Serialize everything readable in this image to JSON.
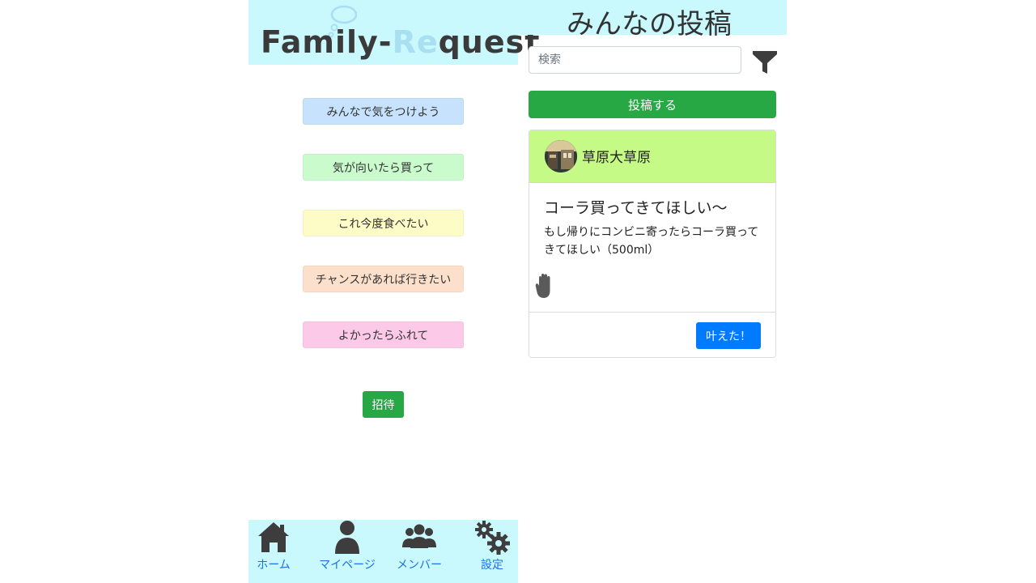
{
  "app": {
    "logo_part1": "Family-",
    "logo_part2": "Re",
    "logo_part3": "quest"
  },
  "categories": [
    {
      "label": "みんなで気をつけよう",
      "color": "#c6e2fc"
    },
    {
      "label": "気が向いたら買って",
      "color": "#c9fbcd"
    },
    {
      "label": "これ今度食べたい",
      "color": "#fdfcc6"
    },
    {
      "label": "チャンスがあれば行きたい",
      "color": "#fde0cc"
    },
    {
      "label": "よかったらふれて",
      "color": "#fccae8"
    }
  ],
  "invite": {
    "label": "招待"
  },
  "nav": [
    {
      "label": "ホーム",
      "icon": "home-icon"
    },
    {
      "label": "マイページ",
      "icon": "user-icon"
    },
    {
      "label": "メンバー",
      "icon": "members-icon"
    },
    {
      "label": "設定",
      "icon": "gear-icon"
    }
  ],
  "header": {
    "title": "みんなの投稿"
  },
  "search": {
    "placeholder": "検索"
  },
  "post": {
    "label": "投稿する"
  },
  "card": {
    "author": "草原大草原",
    "title": "コーラ買ってきてほしい〜",
    "text": "もし帰りにコンビニ寄ったらコーラ買ってきてほしい（500ml）",
    "action": "叶えた！"
  },
  "colors": {
    "accent_cyan": "#c9f8fd",
    "green": "#28a745",
    "blue": "#007bff",
    "card_header": "#c4fa85",
    "nav_text": "#1a73e8"
  }
}
